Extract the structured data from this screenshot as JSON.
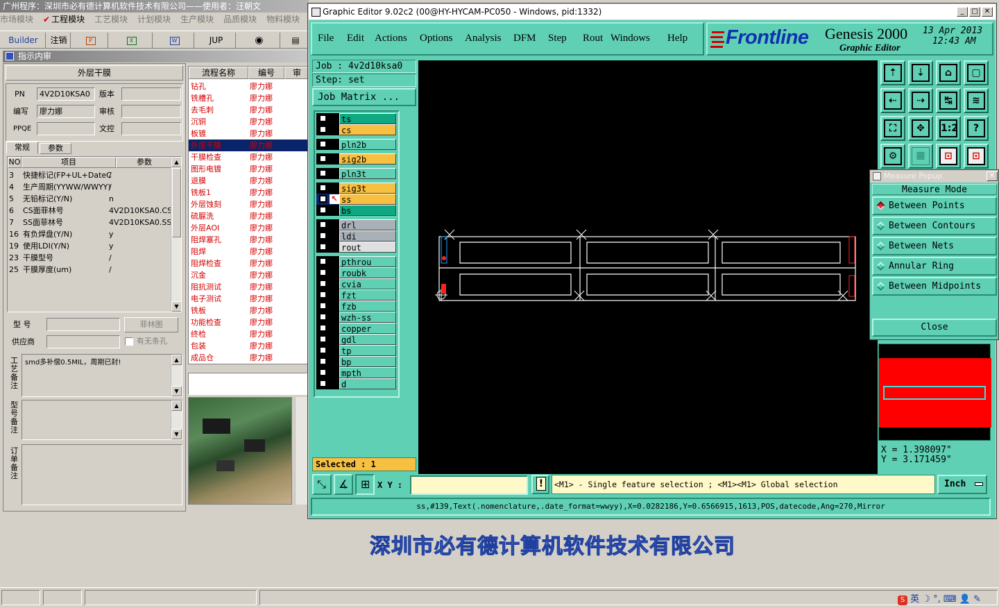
{
  "host": {
    "title": "广州程序：深圳市必有德计算机软件技术有限公司——使用者：汪朝文",
    "menu": [
      "市场模块",
      "工程模块",
      "工艺模块",
      "计划模块",
      "生产模块",
      "品质模块",
      "物料模块"
    ],
    "menu_active_index": 1,
    "toolbar": {
      "builder": "Builder",
      "cancel": "注销",
      "jup": "JUP"
    },
    "subwindow_title": "指示内审",
    "section_title": "外层干膜",
    "fields": {
      "pn_label": "PN",
      "pn_value": "4V2D10KSA0",
      "version_label": "版本",
      "version_value": "",
      "writer_label": "编写",
      "writer_value": "廖力娜",
      "review_label": "审核",
      "review_value": "",
      "ppqe_label": "PPQE",
      "ppqe_value": "",
      "control_label": "文控",
      "control_value": ""
    },
    "tabs": [
      "常规",
      "参数"
    ],
    "grid": {
      "headers": [
        "NO",
        "项目",
        "参数"
      ],
      "rows": [
        {
          "no": "3",
          "item": "快捷标记(FP+UL+DateC",
          "param": "/"
        },
        {
          "no": "4",
          "item": "生产周期(YYWW/WWYY)",
          "param": "/"
        },
        {
          "no": "5",
          "item": "无铅标记(Y/N)",
          "param": "n"
        },
        {
          "no": "6",
          "item": "CS面菲林号",
          "param": "4V2D10KSA0.CS"
        },
        {
          "no": "7",
          "item": "SS面菲林号",
          "param": "4V2D10KSA0.SS"
        },
        {
          "no": "16",
          "item": "有负焊盘(Y/N)",
          "param": "y"
        },
        {
          "no": "19",
          "item": "使用LDI(Y/N)",
          "param": "y"
        },
        {
          "no": "23",
          "item": "干膜型号",
          "param": "/"
        },
        {
          "no": "25",
          "item": "干膜厚度(um)",
          "param": "/"
        }
      ]
    },
    "model_label": "型 号",
    "model_value": "",
    "film_button": "菲林图",
    "supplier_label": "供应商",
    "supplier_value": "",
    "hole_checkbox": "有无条孔",
    "process_note_label": "工艺备注",
    "process_note": "smd多补偿0.5MIL，周期已封!",
    "model_note_label": "型号备注",
    "order_note_label": "订单备注",
    "flow": {
      "headers": [
        "流程名称",
        "编号",
        "审"
      ],
      "selected_index": 5,
      "rows": [
        {
          "name": "钻孔",
          "code": "廖力娜"
        },
        {
          "name": "铣槽孔",
          "code": "廖力娜"
        },
        {
          "name": "去毛刺",
          "code": "廖力娜"
        },
        {
          "name": "沉铜",
          "code": "廖力娜"
        },
        {
          "name": "板镀",
          "code": "廖力娜"
        },
        {
          "name": "外层干膜",
          "code": "廖力娜"
        },
        {
          "name": "干膜检查",
          "code": "廖力娜"
        },
        {
          "name": "图形电镀",
          "code": "廖力娜"
        },
        {
          "name": "退膜",
          "code": "廖力娜"
        },
        {
          "name": "铣板1",
          "code": "廖力娜"
        },
        {
          "name": "外层蚀刻",
          "code": "廖力娜"
        },
        {
          "name": "硫脲洗",
          "code": "廖力娜"
        },
        {
          "name": "外层AOI",
          "code": "廖力娜"
        },
        {
          "name": "阻焊塞孔",
          "code": "廖力娜"
        },
        {
          "name": "阻焊",
          "code": "廖力娜"
        },
        {
          "name": "阻焊检查",
          "code": "廖力娜"
        },
        {
          "name": "沉金",
          "code": "廖力娜"
        },
        {
          "name": "阻抗测试",
          "code": "廖力娜"
        },
        {
          "name": "电子测试",
          "code": "廖力娜"
        },
        {
          "name": "铣板",
          "code": "廖力娜"
        },
        {
          "name": "功能检查",
          "code": "廖力娜"
        },
        {
          "name": "终检",
          "code": "廖力娜"
        },
        {
          "name": "包装",
          "code": "廖力娜"
        },
        {
          "name": "成品仓",
          "code": "廖力娜"
        }
      ]
    }
  },
  "genesis": {
    "window_title": "Graphic Editor 9.02c2 (00@HY-HYCAM-PC050 - Windows, pid:1332)",
    "menu": [
      "File",
      "Edit",
      "Actions",
      "Options",
      "Analysis",
      "DFM",
      "Step",
      "Rout",
      "Windows",
      "Help"
    ],
    "brand": {
      "logo": "Frontline",
      "product": "Genesis 2000",
      "subtitle": "Graphic Editor",
      "date": "13 Apr 2013",
      "time": "12:43 AM"
    },
    "job_label": "Job : 4v2d10ksa0",
    "step_label": "Step: set",
    "job_matrix_button": "Job Matrix ...",
    "layers": [
      {
        "name": "ts",
        "color": "#0fa882",
        "group": 0
      },
      {
        "name": "cs",
        "color": "#f8c040",
        "group": 0
      },
      {
        "name": "pln2b",
        "color": "#5fd0b4",
        "group": 1
      },
      {
        "name": "sig2b",
        "color": "#f8c040",
        "group": 2
      },
      {
        "name": "pln3t",
        "color": "#5fd0b4",
        "group": 3
      },
      {
        "name": "sig3t",
        "color": "#f8c040",
        "group": 4
      },
      {
        "name": "ss",
        "color": "#f8c040",
        "group": 4,
        "work": true
      },
      {
        "name": "bs",
        "color": "#0fa882",
        "group": 4
      },
      {
        "name": "drl",
        "color": "#a8b0b8",
        "group": 5
      },
      {
        "name": "ldi",
        "color": "#a8b0b8",
        "group": 5
      },
      {
        "name": "rout",
        "color": "#e0e0e0",
        "group": 5
      },
      {
        "name": "pthrou",
        "color": "#5fd0b4",
        "group": 6
      },
      {
        "name": "roubk",
        "color": "#5fd0b4",
        "group": 6
      },
      {
        "name": "cvia",
        "color": "#5fd0b4",
        "group": 6
      },
      {
        "name": "fzt",
        "color": "#5fd0b4",
        "group": 6
      },
      {
        "name": "fzb",
        "color": "#5fd0b4",
        "group": 6
      },
      {
        "name": "wzh-ss",
        "color": "#5fd0b4",
        "group": 6
      },
      {
        "name": "copper",
        "color": "#5fd0b4",
        "group": 6
      },
      {
        "name": "gdl",
        "color": "#5fd0b4",
        "group": 6
      },
      {
        "name": "tp",
        "color": "#5fd0b4",
        "group": 6
      },
      {
        "name": "bp",
        "color": "#5fd0b4",
        "group": 6
      },
      {
        "name": "mpth",
        "color": "#5fd0b4",
        "group": 6
      },
      {
        "name": "d",
        "color": "#5fd0b4",
        "group": 6
      }
    ],
    "selected_label": "Selected : 1",
    "xy_label": "X Y :",
    "xy_value": "",
    "hint": "<M1> - Single feature selection ; <M1><M1> Global selection",
    "unit": "Inch",
    "status": "ss,#139,Text(.nomenclature,.date_format=wwyy),X=0.0282186,Y=0.6566915,1613,POS,datecode,Ang=270,Mirror",
    "coords": {
      "x": "X = 1.398097\"",
      "y": "Y = 3.171459\""
    },
    "tools": [
      "zoom-home-icon",
      "zoom-out-icon",
      "home-icon",
      "window-icon",
      "pan-left-icon",
      "pan-right-icon",
      "fit-icon",
      "snap-icon",
      "fit-all-icon",
      "center-icon",
      "one-to-one-icon",
      "help-icon",
      "settings-icon",
      "grid-icon",
      "net-icon",
      "net2-icon"
    ]
  },
  "measure": {
    "title": "Measure Popup",
    "mode_label": "Measure Mode",
    "options": [
      "Between Points",
      "Between Contours",
      "Between Nets",
      "Annular Ring",
      "Between Midpoints"
    ],
    "selected_index": 0,
    "close": "Close"
  },
  "desktop": {
    "banner": "深圳市必有德计算机软件技术有限公司",
    "tray_ime": "英"
  }
}
